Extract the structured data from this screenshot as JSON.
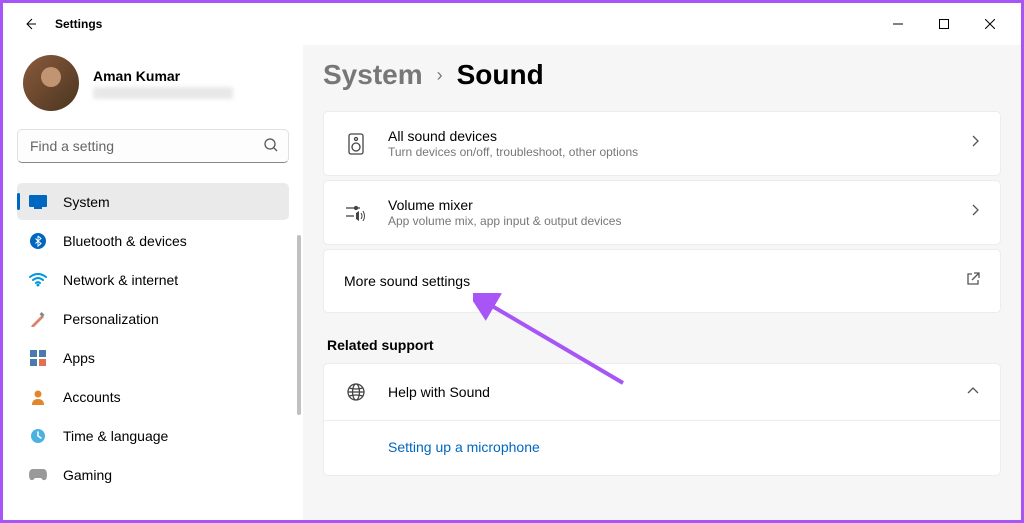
{
  "window": {
    "title": "Settings"
  },
  "profile": {
    "name": "Aman Kumar"
  },
  "search": {
    "placeholder": "Find a setting"
  },
  "sidebar": {
    "items": [
      {
        "label": "System"
      },
      {
        "label": "Bluetooth & devices"
      },
      {
        "label": "Network & internet"
      },
      {
        "label": "Personalization"
      },
      {
        "label": "Apps"
      },
      {
        "label": "Accounts"
      },
      {
        "label": "Time & language"
      },
      {
        "label": "Gaming"
      }
    ]
  },
  "breadcrumb": {
    "parent": "System",
    "current": "Sound"
  },
  "cards": {
    "all_devices": {
      "title": "All sound devices",
      "sub": "Turn devices on/off, troubleshoot, other options"
    },
    "volume_mixer": {
      "title": "Volume mixer",
      "sub": "App volume mix, app input & output devices"
    },
    "more_settings": {
      "title": "More sound settings"
    }
  },
  "related": {
    "heading": "Related support",
    "help_title": "Help with Sound",
    "link1": "Setting up a microphone"
  }
}
